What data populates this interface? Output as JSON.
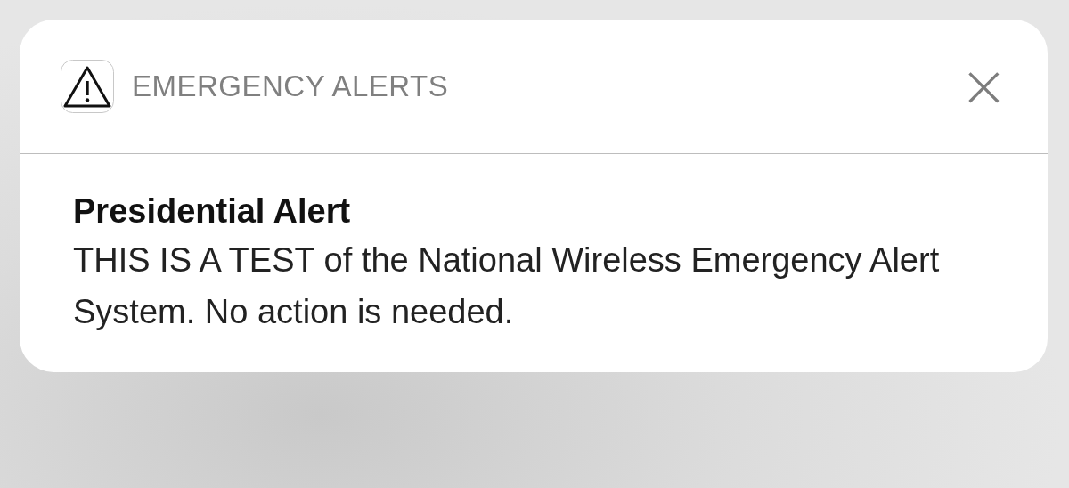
{
  "notification": {
    "app_name": "EMERGENCY ALERTS",
    "title": "Presidential Alert",
    "body": "THIS IS A TEST of the National Wireless Emergency Alert System. No action is needed.",
    "close_button": "×"
  }
}
